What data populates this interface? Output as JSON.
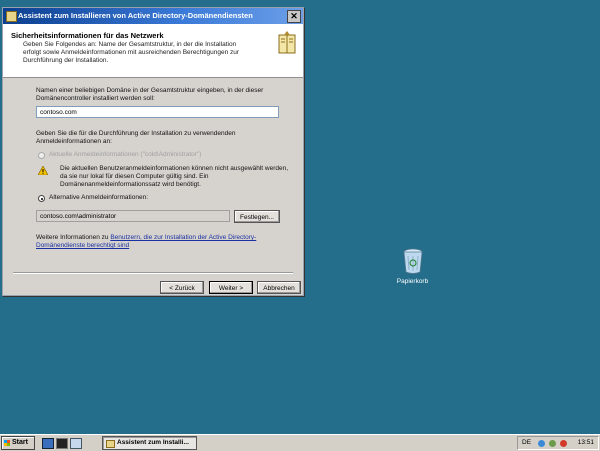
{
  "window": {
    "title": "Assistent zum Installieren von Active Directory-Domänendiensten",
    "close_glyph": "✕"
  },
  "header": {
    "title": "Sicherheitsinformationen für das Netzwerk",
    "description": "Geben Sie Folgendes an: Name der Gesamtstruktur, in der die Installation erfolgt sowie Anmeldeinformationen mit ausreichenden Berechtigungen zur Durchführung der Installation.",
    "icon": "book-icon"
  },
  "domain": {
    "label": "Namen einer beliebigen Domäne in der Gesamtstruktur eingeben, in der dieser Domänencontroller installiert werden soll:",
    "value": "contoso.com"
  },
  "credentials": {
    "label": "Geben Sie die für die Durchführung der Installation zu verwendenden Anmeldeinformationen an:",
    "current_option": "Aktuelle Anmeldeinformationen (\"cold\\Administrator\")",
    "warning_text": "Die aktuellen Benutzeranmeldeinformationen können nicht ausgewählt werden, da sie nur lokal für diesen Computer gültig sind. Ein Domänenanmeldeinformationssatz wird benötigt.",
    "alternate_option": "Alternative Anmeldeinformationen:",
    "alternate_value": "contoso.com\\administrator",
    "set_button": "Festlegen..."
  },
  "more_info": {
    "prefix": "Weitere Informationen zu ",
    "link": "Benutzern, die zur Installation der Active Directory-Domänendienste berechtigt sind"
  },
  "buttons": {
    "back": "< Zurück",
    "next": "Weiter >",
    "cancel": "Abbrechen"
  },
  "desktop": {
    "recycle_bin_label": "Papierkorb"
  },
  "taskbar": {
    "start_label": "Start",
    "task_label": "Assistent zum Installi...",
    "language": "DE",
    "clock": "13:51"
  },
  "colors": {
    "desktop": "#246e8c",
    "titlebar": "#0b3f8f",
    "link": "#1a2fa0"
  }
}
